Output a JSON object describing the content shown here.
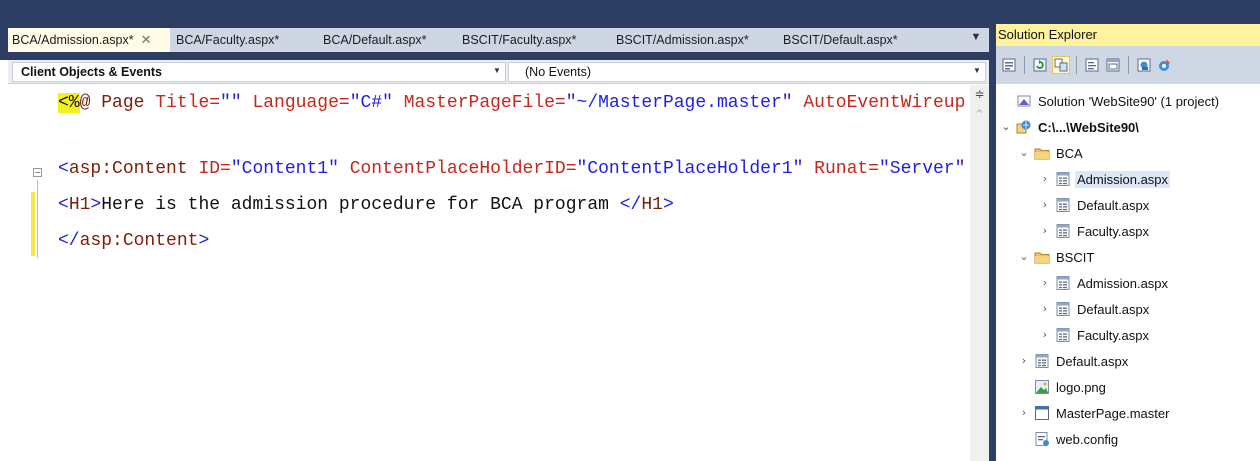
{
  "editor": {
    "tabs": [
      {
        "label": "BCA/Admission.aspx*",
        "active": true,
        "close": "✕"
      },
      {
        "label": "BCA/Faculty.aspx*"
      },
      {
        "label": "BCA/Default.aspx*"
      },
      {
        "label": "BSCIT/Faculty.aspx*"
      },
      {
        "label": "BSCIT/Admission.aspx*"
      },
      {
        "label": "BSCIT/Default.aspx*"
      }
    ],
    "tab_dropdown_glyph": "▼",
    "objects_combo": {
      "value": "Client Objects & Events"
    },
    "events_combo": {
      "value": "(No Events)"
    },
    "code_lines": [
      {
        "segments": [
          {
            "text": "<%",
            "style": "hl"
          },
          {
            "text": "@ Page ",
            "style": "maroon"
          },
          {
            "text": "Title=",
            "style": "red"
          },
          {
            "text": "\"\"",
            "style": "blue"
          },
          {
            "text": " Language=",
            "style": "red"
          },
          {
            "text": "\"C#\"",
            "style": "blue"
          },
          {
            "text": " MasterPageFile=",
            "style": "red"
          },
          {
            "text": "\"~/MasterPage.master\"",
            "style": "blue"
          },
          {
            "text": " AutoEventWireup",
            "style": "red"
          }
        ]
      },
      {
        "segments": []
      },
      {
        "segments": [
          {
            "text": "<",
            "style": "blue"
          },
          {
            "text": "asp:Content",
            "style": "maroon"
          },
          {
            "text": " ID=",
            "style": "red"
          },
          {
            "text": "\"Content1\"",
            "style": "blue"
          },
          {
            "text": " ContentPlaceHolderID=",
            "style": "red"
          },
          {
            "text": "\"ContentPlaceHolder1\"",
            "style": "blue"
          },
          {
            "text": " Runat=",
            "style": "red"
          },
          {
            "text": "\"Server\"",
            "style": "blue"
          }
        ]
      },
      {
        "segments": [
          {
            "text": "<",
            "style": "blue"
          },
          {
            "text": "H1",
            "style": "maroon"
          },
          {
            "text": ">",
            "style": "blue"
          },
          {
            "text": "Here is the admission procedure for BCA program ",
            "style": "text"
          },
          {
            "text": "</",
            "style": "blue"
          },
          {
            "text": "H1",
            "style": "maroon"
          },
          {
            "text": ">",
            "style": "blue"
          }
        ]
      },
      {
        "segments": [
          {
            "text": "</",
            "style": "blue"
          },
          {
            "text": "asp:Content",
            "style": "maroon"
          },
          {
            "text": ">",
            "style": "blue"
          }
        ]
      }
    ],
    "collapse_glyph": "−"
  },
  "solution_explorer": {
    "title": "Solution Explorer",
    "toolbar_icons": [
      "properties-icon",
      "refresh-icon",
      "nest-files-icon",
      "view-code-icon",
      "view-designer-icon",
      "copy-website-icon",
      "aspnet-config-icon"
    ],
    "tree": [
      {
        "label": "Solution 'WebSite90' (1 project)",
        "icon": "solution-icon",
        "expander": ""
      },
      {
        "label": "C:\\...\\WebSite90\\",
        "icon": "website-icon",
        "expander": "⌄",
        "bold": true
      },
      {
        "label": "BCA",
        "icon": "folder-icon",
        "expander": "⌄"
      },
      {
        "label": "Admission.aspx",
        "icon": "aspx-file-icon",
        "expander": "›",
        "selected": true
      },
      {
        "label": "Default.aspx",
        "icon": "aspx-file-icon",
        "expander": "›"
      },
      {
        "label": "Faculty.aspx",
        "icon": "aspx-file-icon",
        "expander": "›"
      },
      {
        "label": "BSCIT",
        "icon": "folder-icon",
        "expander": "⌄"
      },
      {
        "label": "Admission.aspx",
        "icon": "aspx-file-icon",
        "expander": "›"
      },
      {
        "label": "Default.aspx",
        "icon": "aspx-file-icon",
        "expander": "›"
      },
      {
        "label": "Faculty.aspx",
        "icon": "aspx-file-icon",
        "expander": "›"
      },
      {
        "label": "Default.aspx",
        "icon": "aspx-file-icon",
        "expander": "›"
      },
      {
        "label": "logo.png",
        "icon": "image-file-icon",
        "expander": ""
      },
      {
        "label": "MasterPage.master",
        "icon": "master-page-icon",
        "expander": "›"
      },
      {
        "label": "web.config",
        "icon": "config-file-icon",
        "expander": ""
      }
    ]
  },
  "colors": {
    "chrome": "#2d3e62",
    "tab_strip": "#ced6e4",
    "active_tab": "#fffbe8",
    "se_title": "#fff29d",
    "selection": "#dce7f7"
  }
}
